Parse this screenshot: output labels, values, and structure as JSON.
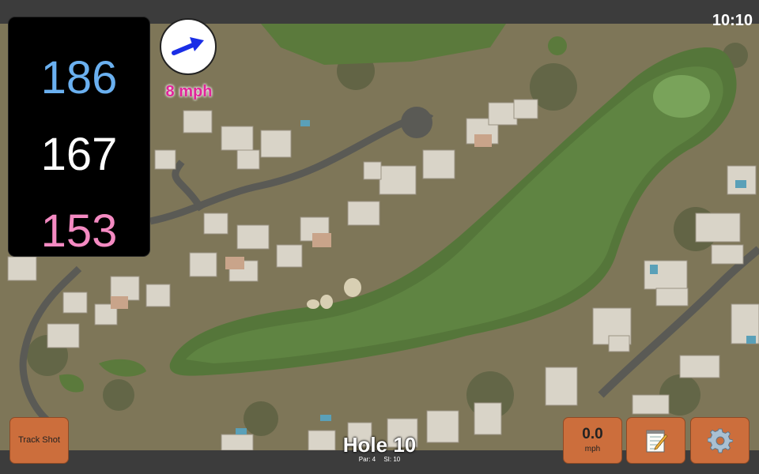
{
  "status_bar": {
    "time": "10:10"
  },
  "distances": {
    "back": "186",
    "middle": "167",
    "front": "153"
  },
  "wind": {
    "speed_label": "8 mph",
    "icon": "wind-arrow-icon"
  },
  "buttons": {
    "track_shot_label": "Track Shot",
    "wind_value": "0.0",
    "wind_unit": "mph",
    "notes_icon": "notepad-icon",
    "settings_icon": "gear-icon"
  },
  "hole": {
    "title": "Hole 10",
    "par_label": "Par: 4",
    "si_label": "SI: 10"
  },
  "colors": {
    "back": "#6ab0f0",
    "middle": "#ffffff",
    "front": "#f48ac2",
    "wind_text": "#e1259a",
    "button": "#cc6e3c"
  }
}
